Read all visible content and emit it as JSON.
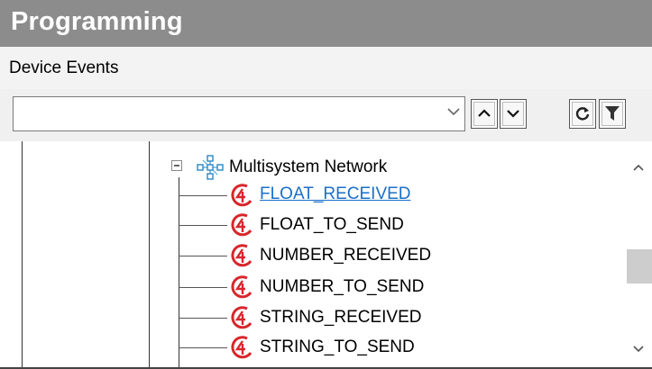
{
  "window": {
    "title": "Programming"
  },
  "subheader": {
    "label": "Device Events"
  },
  "toolbar": {
    "search_value": "",
    "buttons": [
      "chevron-up-icon",
      "chevron-down-icon",
      "refresh-icon",
      "filter-icon"
    ]
  },
  "tree": {
    "group_label": "Multisystem Network",
    "items": [
      {
        "label": "FLOAT_RECEIVED",
        "selected": true
      },
      {
        "label": "FLOAT_TO_SEND",
        "selected": false
      },
      {
        "label": "NUMBER_RECEIVED",
        "selected": false
      },
      {
        "label": "NUMBER_TO_SEND",
        "selected": false
      },
      {
        "label": "STRING_RECEIVED",
        "selected": false
      },
      {
        "label": "STRING_TO_SEND",
        "selected": false
      }
    ],
    "link_color": "#1a6fc9",
    "icon_color": "#d8262b"
  }
}
